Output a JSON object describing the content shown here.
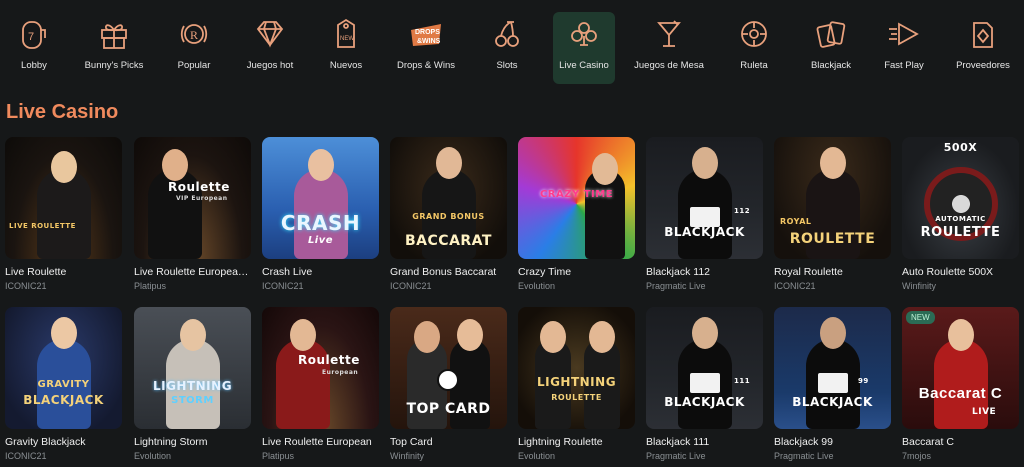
{
  "nav": [
    {
      "label": "Lobby",
      "icon": "slot-machine-icon",
      "active": false
    },
    {
      "label": "Bunny's Picks",
      "icon": "gift-icon",
      "active": false
    },
    {
      "label": "Popular",
      "icon": "royal-badge-icon",
      "active": false
    },
    {
      "label": "Juegos hot",
      "icon": "diamond-icon",
      "active": false
    },
    {
      "label": "Nuevos",
      "icon": "new-tag-icon",
      "active": false
    },
    {
      "label": "Drops & Wins",
      "icon": "drops-wins-icon",
      "active": false
    },
    {
      "label": "Slots",
      "icon": "cherry-icon",
      "active": false
    },
    {
      "label": "Live Casino",
      "icon": "club-icon",
      "active": true
    },
    {
      "label": "Juegos de Mesa",
      "icon": "cocktail-icon",
      "active": false
    },
    {
      "label": "Ruleta",
      "icon": "roulette-icon",
      "active": false
    },
    {
      "label": "Blackjack",
      "icon": "cards-icon",
      "active": false
    },
    {
      "label": "Fast Play",
      "icon": "fast-play-icon",
      "active": false
    },
    {
      "label": "Proveedores",
      "icon": "provider-icon",
      "active": false
    }
  ],
  "section_title": "Live Casino",
  "colors": {
    "accent": "#f08a5d",
    "icon": "#e8a07c",
    "active_bg": "#1f3a2e"
  },
  "games": [
    {
      "name": "Live Roulette",
      "provider": "ICONIC21",
      "art": "LIVE ROULETTE",
      "art_sub": "",
      "new": false
    },
    {
      "name": "Live Roulette European VIP",
      "provider": "Platipus",
      "art": "Roulette",
      "art_sub": "VIP European",
      "new": false
    },
    {
      "name": "Crash Live",
      "provider": "ICONIC21",
      "art": "CRASH",
      "art_sub": "Live",
      "new": false
    },
    {
      "name": "Grand Bonus Baccarat",
      "provider": "ICONIC21",
      "art": "BACCARAT",
      "art_sub": "GRAND BONUS",
      "new": false
    },
    {
      "name": "Crazy Time",
      "provider": "Evolution",
      "art": "CRAZY TIME",
      "art_sub": "",
      "new": false
    },
    {
      "name": "Blackjack 112",
      "provider": "Pragmatic Live",
      "art": "BLACKJACK",
      "art_sub": "112",
      "new": false
    },
    {
      "name": "Royal Roulette",
      "provider": "ICONIC21",
      "art": "ROULETTE",
      "art_sub": "ROYAL",
      "new": false
    },
    {
      "name": "Auto Roulette 500X",
      "provider": "Winfinity",
      "art": "ROULETTE",
      "art_sub": "AUTOMATIC",
      "new": false
    },
    {
      "name": "Gravity Blackjack",
      "provider": "ICONIC21",
      "art": "BLACKJACK",
      "art_sub": "GRAVITY",
      "new": false
    },
    {
      "name": "Lightning Storm",
      "provider": "Evolution",
      "art": "LIGHTNING",
      "art_sub": "STORM",
      "new": false
    },
    {
      "name": "Live Roulette European",
      "provider": "Platipus",
      "art": "Roulette",
      "art_sub": "European",
      "new": false
    },
    {
      "name": "Top Card",
      "provider": "Winfinity",
      "art": "TOP CARD",
      "art_sub": "",
      "new": false
    },
    {
      "name": "Lightning Roulette",
      "provider": "Evolution",
      "art": "LIGHTNING",
      "art_sub": "ROULETTE",
      "new": false
    },
    {
      "name": "Blackjack 111",
      "provider": "Pragmatic Live",
      "art": "BLACKJACK",
      "art_sub": "111",
      "new": false
    },
    {
      "name": "Blackjack 99",
      "provider": "Pragmatic Live",
      "art": "BLACKJACK",
      "art_sub": "99",
      "new": false
    },
    {
      "name": "Baccarat C",
      "provider": "7mojos",
      "art": "Baccarat C",
      "art_sub": "LIVE",
      "new": true,
      "new_label": "NEW"
    }
  ]
}
